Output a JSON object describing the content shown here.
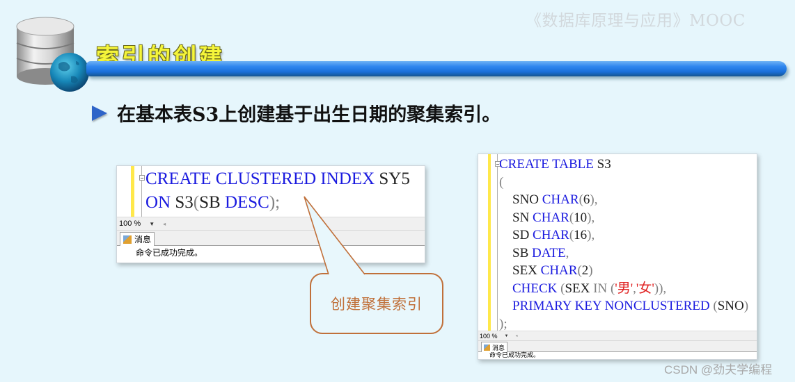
{
  "header": {
    "course_watermark": "《数据库原理与应用》MOOC",
    "section_title": "索引的创建"
  },
  "bullet": {
    "text": "在基本表S3上创建基于出生日期的聚集索引。"
  },
  "query_window_left": {
    "lines": [
      [
        {
          "t": "CREATE CLUSTERED INDEX",
          "c": "kw"
        },
        {
          "t": " SY5",
          "c": ""
        }
      ],
      [
        {
          "t": "ON",
          "c": "kw"
        },
        {
          "t": " S3",
          "c": ""
        },
        {
          "t": "(",
          "c": "gray"
        },
        {
          "t": "SB ",
          "c": ""
        },
        {
          "t": "DESC",
          "c": "kw"
        },
        {
          "t": ")",
          "c": "gray"
        },
        {
          "t": ";",
          "c": "gray"
        }
      ]
    ],
    "zoom_level": "100 %",
    "messages_tab": "消息",
    "message": "命令已成功完成。"
  },
  "query_window_right": {
    "lines": [
      [
        {
          "t": "CREATE TABLE",
          "c": "kw"
        },
        {
          "t": " S3",
          "c": ""
        }
      ],
      [
        {
          "t": "(",
          "c": "gray"
        }
      ],
      [
        {
          "t": "    SNO ",
          "c": ""
        },
        {
          "t": "CHAR",
          "c": "kw"
        },
        {
          "t": "(",
          "c": "gray"
        },
        {
          "t": "6",
          "c": ""
        },
        {
          "t": "),",
          "c": "gray"
        }
      ],
      [
        {
          "t": "    SN ",
          "c": ""
        },
        {
          "t": "CHAR",
          "c": "kw"
        },
        {
          "t": "(",
          "c": "gray"
        },
        {
          "t": "10",
          "c": ""
        },
        {
          "t": "),",
          "c": "gray"
        }
      ],
      [
        {
          "t": "    SD ",
          "c": ""
        },
        {
          "t": "CHAR",
          "c": "kw"
        },
        {
          "t": "(",
          "c": "gray"
        },
        {
          "t": "16",
          "c": ""
        },
        {
          "t": "),",
          "c": "gray"
        }
      ],
      [
        {
          "t": "    SB ",
          "c": ""
        },
        {
          "t": "DATE",
          "c": "kw"
        },
        {
          "t": ",",
          "c": "gray"
        }
      ],
      [
        {
          "t": "    SEX ",
          "c": ""
        },
        {
          "t": "CHAR",
          "c": "kw"
        },
        {
          "t": "(",
          "c": "gray"
        },
        {
          "t": "2",
          "c": ""
        },
        {
          "t": ")",
          "c": "gray"
        }
      ],
      [
        {
          "t": "    CHECK",
          "c": "kw"
        },
        {
          "t": " (",
          "c": "gray"
        },
        {
          "t": "SEX ",
          "c": ""
        },
        {
          "t": "IN",
          "c": "gray"
        },
        {
          "t": " (",
          "c": "gray"
        },
        {
          "t": "'男'",
          "c": "str"
        },
        {
          "t": ",",
          "c": "gray"
        },
        {
          "t": "'女'",
          "c": "str"
        },
        {
          "t": ")),",
          "c": "gray"
        }
      ],
      [
        {
          "t": "    PRIMARY KEY NONCLUSTERED",
          "c": "kw"
        },
        {
          "t": " (",
          "c": "gray"
        },
        {
          "t": "SNO",
          "c": ""
        },
        {
          "t": ")",
          "c": "gray"
        }
      ],
      [
        {
          "t": ");",
          "c": "gray"
        }
      ]
    ],
    "zoom_level": "100 %",
    "messages_tab": "消息",
    "message": "命令已成功完成。"
  },
  "callout": {
    "text": "创建聚集索引"
  },
  "footer": {
    "attribution": "CSDN @劲夫学编程"
  },
  "colors": {
    "keyword": "#1a1adf",
    "string": "#e02020",
    "callout": "#c0703a",
    "title_yellow": "#f5f53a",
    "title_bar_blue": "#2f86ee",
    "background": "#e6f6fc"
  }
}
